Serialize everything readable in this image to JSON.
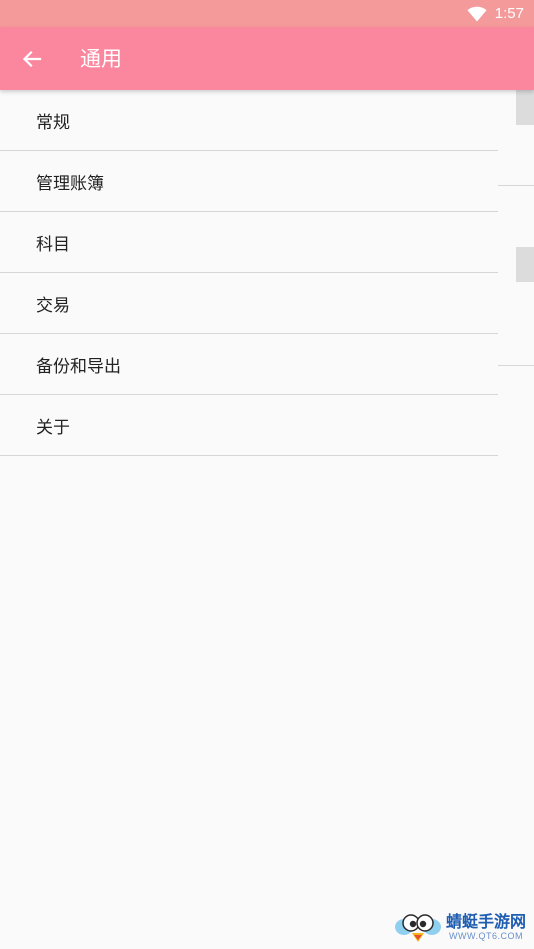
{
  "status_bar": {
    "time": "1:57",
    "wifi_icon": "wifi-icon",
    "background_color": "#f59a9b"
  },
  "app_bar": {
    "back_icon": "arrow-left-icon",
    "title": "通用",
    "background_color": "#fb879f"
  },
  "settings": {
    "items": [
      {
        "label": "常规"
      },
      {
        "label": "管理账簿"
      },
      {
        "label": "科目"
      },
      {
        "label": "交易"
      },
      {
        "label": "备份和导出"
      },
      {
        "label": "关于"
      }
    ]
  },
  "watermark": {
    "name": "蜻蜓手游网",
    "url": "WWW.QT6.COM"
  }
}
